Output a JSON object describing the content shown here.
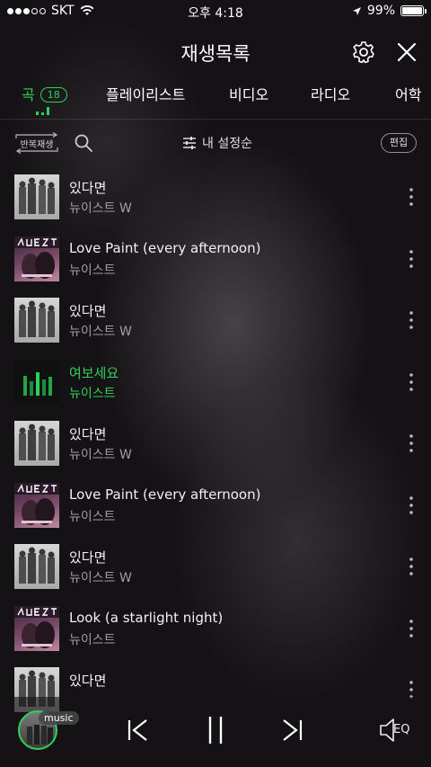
{
  "status_bar": {
    "carrier": "SKT",
    "time": "오후 4:18",
    "battery": "99%",
    "battery_level": 0.99
  },
  "header": {
    "title": "재생목록",
    "icons": [
      "gear-icon",
      "close-icon"
    ]
  },
  "tabs": [
    {
      "label": "곡",
      "badge": "18",
      "active": true
    },
    {
      "label": "플레이리스트"
    },
    {
      "label": "비디오"
    },
    {
      "label": "라디오"
    },
    {
      "label": "어학"
    }
  ],
  "toolbar": {
    "repeat_label": "반복재생",
    "sort_label": "내 설정순",
    "edit_label": "편집"
  },
  "songs": [
    {
      "title": "있다면",
      "artist": "뉴이스트 W",
      "art": "w"
    },
    {
      "title": "Love Paint (every afternoon)",
      "artist": "뉴이스트",
      "art": "nuest"
    },
    {
      "title": "있다면",
      "artist": "뉴이스트 W",
      "art": "w"
    },
    {
      "title": "여보세요",
      "artist": "뉴이스트",
      "art": "yeobo",
      "playing": true
    },
    {
      "title": "있다면",
      "artist": "뉴이스트 W",
      "art": "w"
    },
    {
      "title": "Love Paint (every afternoon)",
      "artist": "뉴이스트",
      "art": "nuest"
    },
    {
      "title": "있다면",
      "artist": "뉴이스트 W",
      "art": "w"
    },
    {
      "title": "Look (a starlight night)",
      "artist": "뉴이스트",
      "art": "nuest"
    },
    {
      "title": "있다면",
      "artist": "",
      "art": "w"
    }
  ],
  "player": {
    "chip_label": "music",
    "eq_label": "EQ"
  },
  "colors": {
    "accent": "#2ed158",
    "background": "#141214"
  }
}
